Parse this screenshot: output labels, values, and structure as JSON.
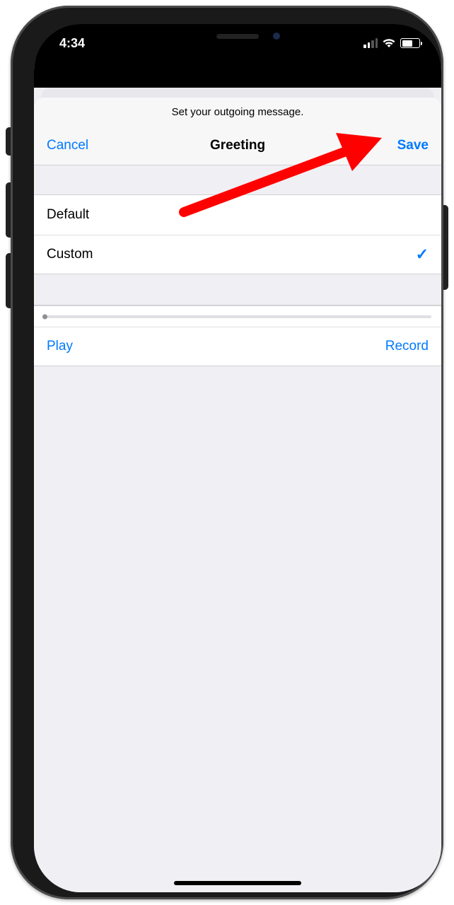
{
  "status": {
    "time": "4:34"
  },
  "sheet": {
    "subtitle": "Set your outgoing message.",
    "cancel": "Cancel",
    "title": "Greeting",
    "save": "Save"
  },
  "options": {
    "default_label": "Default",
    "custom_label": "Custom",
    "selected": "custom"
  },
  "controls": {
    "play": "Play",
    "record": "Record"
  },
  "colors": {
    "tint": "#007aff",
    "annotation": "#ff0000"
  }
}
